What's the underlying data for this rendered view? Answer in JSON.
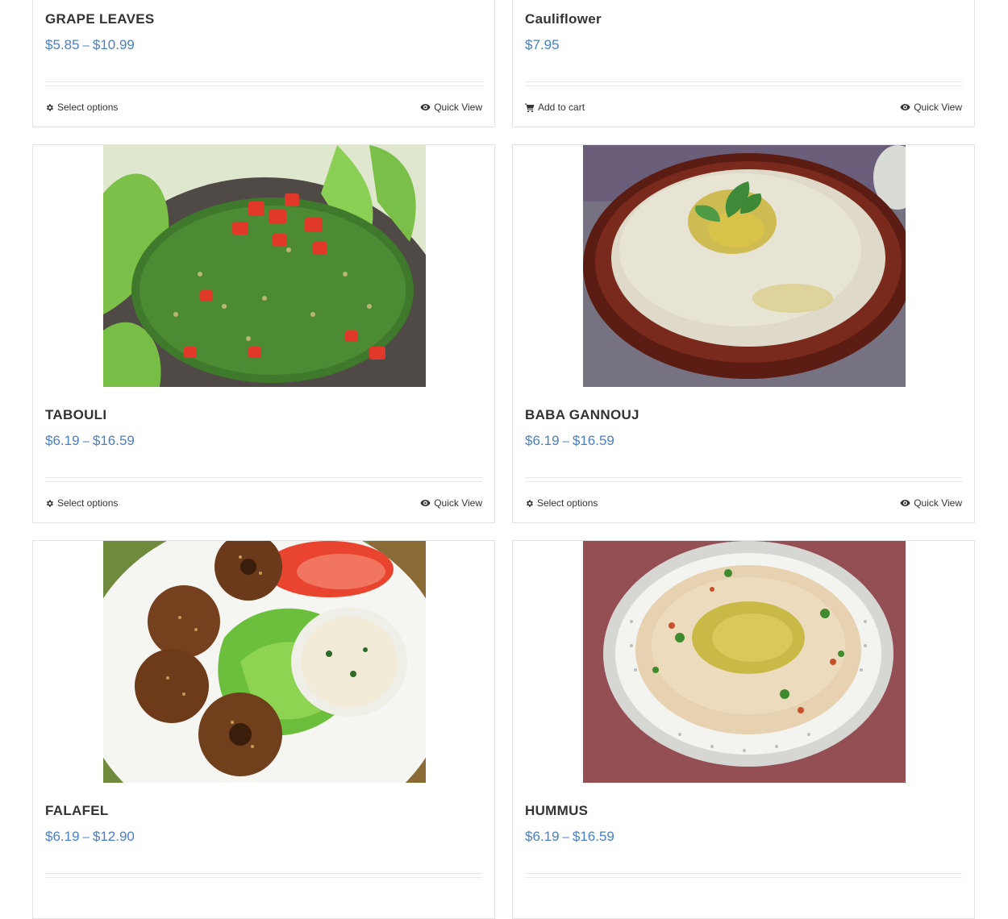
{
  "products": [
    {
      "name": "GRAPE LEAVES",
      "price_from": "$5.85",
      "price_sep": "–",
      "price_to": "$10.99",
      "primary_action": "Select options",
      "primary_icon": "gear-icon",
      "quick_view": "Quick View"
    },
    {
      "name": "Cauliflower",
      "price_from": "$7.95",
      "primary_action": "Add to cart",
      "primary_icon": "cart-icon",
      "quick_view": "Quick View"
    },
    {
      "name": "TABOULI",
      "price_from": "$6.19",
      "price_sep": "–",
      "price_to": "$16.59",
      "primary_action": "Select options",
      "primary_icon": "gear-icon",
      "quick_view": "Quick View"
    },
    {
      "name": "BABA GANNOUJ",
      "price_from": "$6.19",
      "price_sep": "–",
      "price_to": "$16.59",
      "primary_action": "Select options",
      "primary_icon": "gear-icon",
      "quick_view": "Quick View"
    },
    {
      "name": "FALAFEL",
      "price_from": "$6.19",
      "price_sep": "–",
      "price_to": "$12.90"
    },
    {
      "name": "HUMMUS",
      "price_from": "$6.19",
      "price_sep": "–",
      "price_to": "$16.59"
    }
  ],
  "colors": {
    "price": "#4a7fc1",
    "title": "#333333",
    "border": "#e2e2e2"
  }
}
